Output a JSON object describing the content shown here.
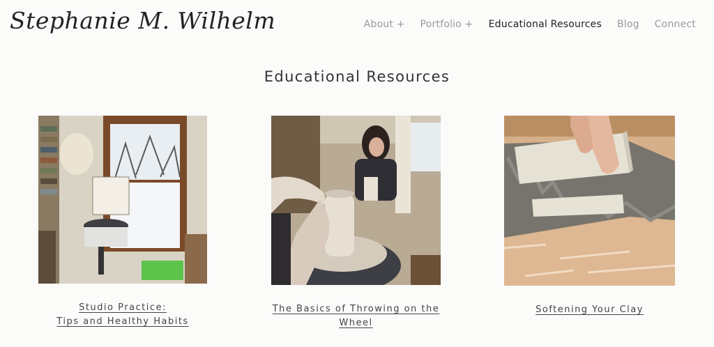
{
  "site": {
    "logo": "Stephanie M. Wilhelm"
  },
  "nav": {
    "items": [
      {
        "label": "About +"
      },
      {
        "label": "Portfolio +"
      },
      {
        "label": "Educational Resources"
      },
      {
        "label": "Blog"
      },
      {
        "label": "Connect"
      }
    ]
  },
  "main": {
    "title": "Educational Resources",
    "cards": [
      {
        "line1": "Studio Practice:",
        "line2": "Tips and Healthy Habits"
      },
      {
        "line1": "The Basics of Throwing on the Wheel"
      },
      {
        "line1": "Softening Your Clay"
      }
    ]
  }
}
